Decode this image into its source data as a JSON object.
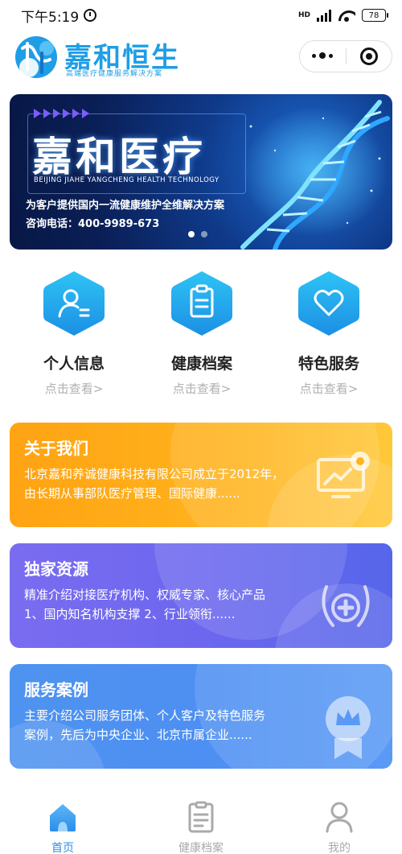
{
  "status_bar": {
    "time": "下午5:19",
    "network": "HD",
    "battery": "78"
  },
  "header": {
    "brand_title": "嘉和恒生",
    "brand_subtitle": "高端医疗健康服务解决方案",
    "logo_letters": "JHS"
  },
  "banner": {
    "title": "嘉和医疗",
    "english": "BEIJING JIAHE YANGCHENG HEALTH TECHNOLOGY",
    "tagline": "为客户提供国内一流健康维护全维解决方案",
    "phone": "咨询电话：400-9989-673"
  },
  "quick": {
    "items": [
      {
        "label": "个人信息",
        "sub": "点击查看>",
        "icon": "person-card-icon"
      },
      {
        "label": "健康档案",
        "sub": "点击查看>",
        "icon": "clipboard-icon"
      },
      {
        "label": "特色服务",
        "sub": "点击查看>",
        "icon": "heart-icon"
      }
    ],
    "accent": "#1f9be8"
  },
  "cards": {
    "about": {
      "title": "关于我们",
      "line1": "北京嘉和养诚健康科技有限公司成立于2012年，",
      "line2": "由长期从事部队医疗管理、国际健康......",
      "icon": "monitor-gear-icon",
      "color": "#ffa313"
    },
    "resources": {
      "title": "独家资源",
      "line1": "精准介绍对接医疗机构、权威专家、核心产品",
      "line2": "1、国内知名机构支撑  2、行业领衔......",
      "icon": "laurel-cross-icon",
      "color": "#6c67ee"
    },
    "cases": {
      "title": "服务案例",
      "line1": "主要介绍公司服务团体、个人客户及特色服务",
      "line2": "案例，先后为中央企业、北京市属企业......",
      "icon": "crown-badge-icon",
      "color": "#4d8ff2"
    }
  },
  "tabbar": {
    "tabs": [
      {
        "label": "首页",
        "icon": "home-icon",
        "active": true
      },
      {
        "label": "健康档案",
        "icon": "document-icon",
        "active": false
      },
      {
        "label": "我的",
        "icon": "user-icon",
        "active": false
      }
    ],
    "active_color": "#2e8ee8"
  }
}
